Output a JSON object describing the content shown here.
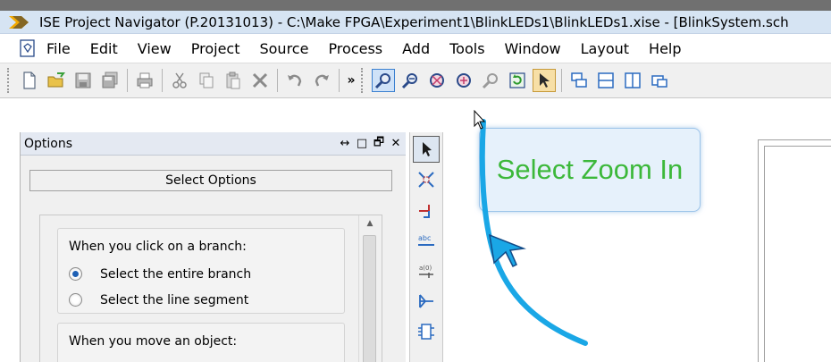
{
  "window": {
    "title": "ISE Project Navigator (P.20131013) - C:\\Make FPGA\\Experiment1\\BlinkLEDs1\\BlinkLEDs1.xise - [BlinkSystem.sch",
    "logo_icon": "xilinx-ise-logo-icon"
  },
  "menu": {
    "items": [
      "File",
      "Edit",
      "View",
      "Project",
      "Source",
      "Process",
      "Add",
      "Tools",
      "Window",
      "Layout",
      "Help"
    ]
  },
  "toolbar": {
    "overflow": "»"
  },
  "options_panel": {
    "title": "Options",
    "controls": [
      "↔",
      "□",
      "🗗",
      "✕"
    ],
    "header_box": "Select Options",
    "group1": {
      "label": "When you click on a branch:",
      "options": [
        "Select the entire branch",
        "Select the line segment"
      ],
      "selected": 0
    },
    "group2": {
      "label": "When you move an object:"
    }
  },
  "callout": {
    "text": "Select Zoom In",
    "color": "#3cb83a"
  },
  "colors": {
    "arrow": "#1aa7e6",
    "accent": "#3b80d0"
  }
}
